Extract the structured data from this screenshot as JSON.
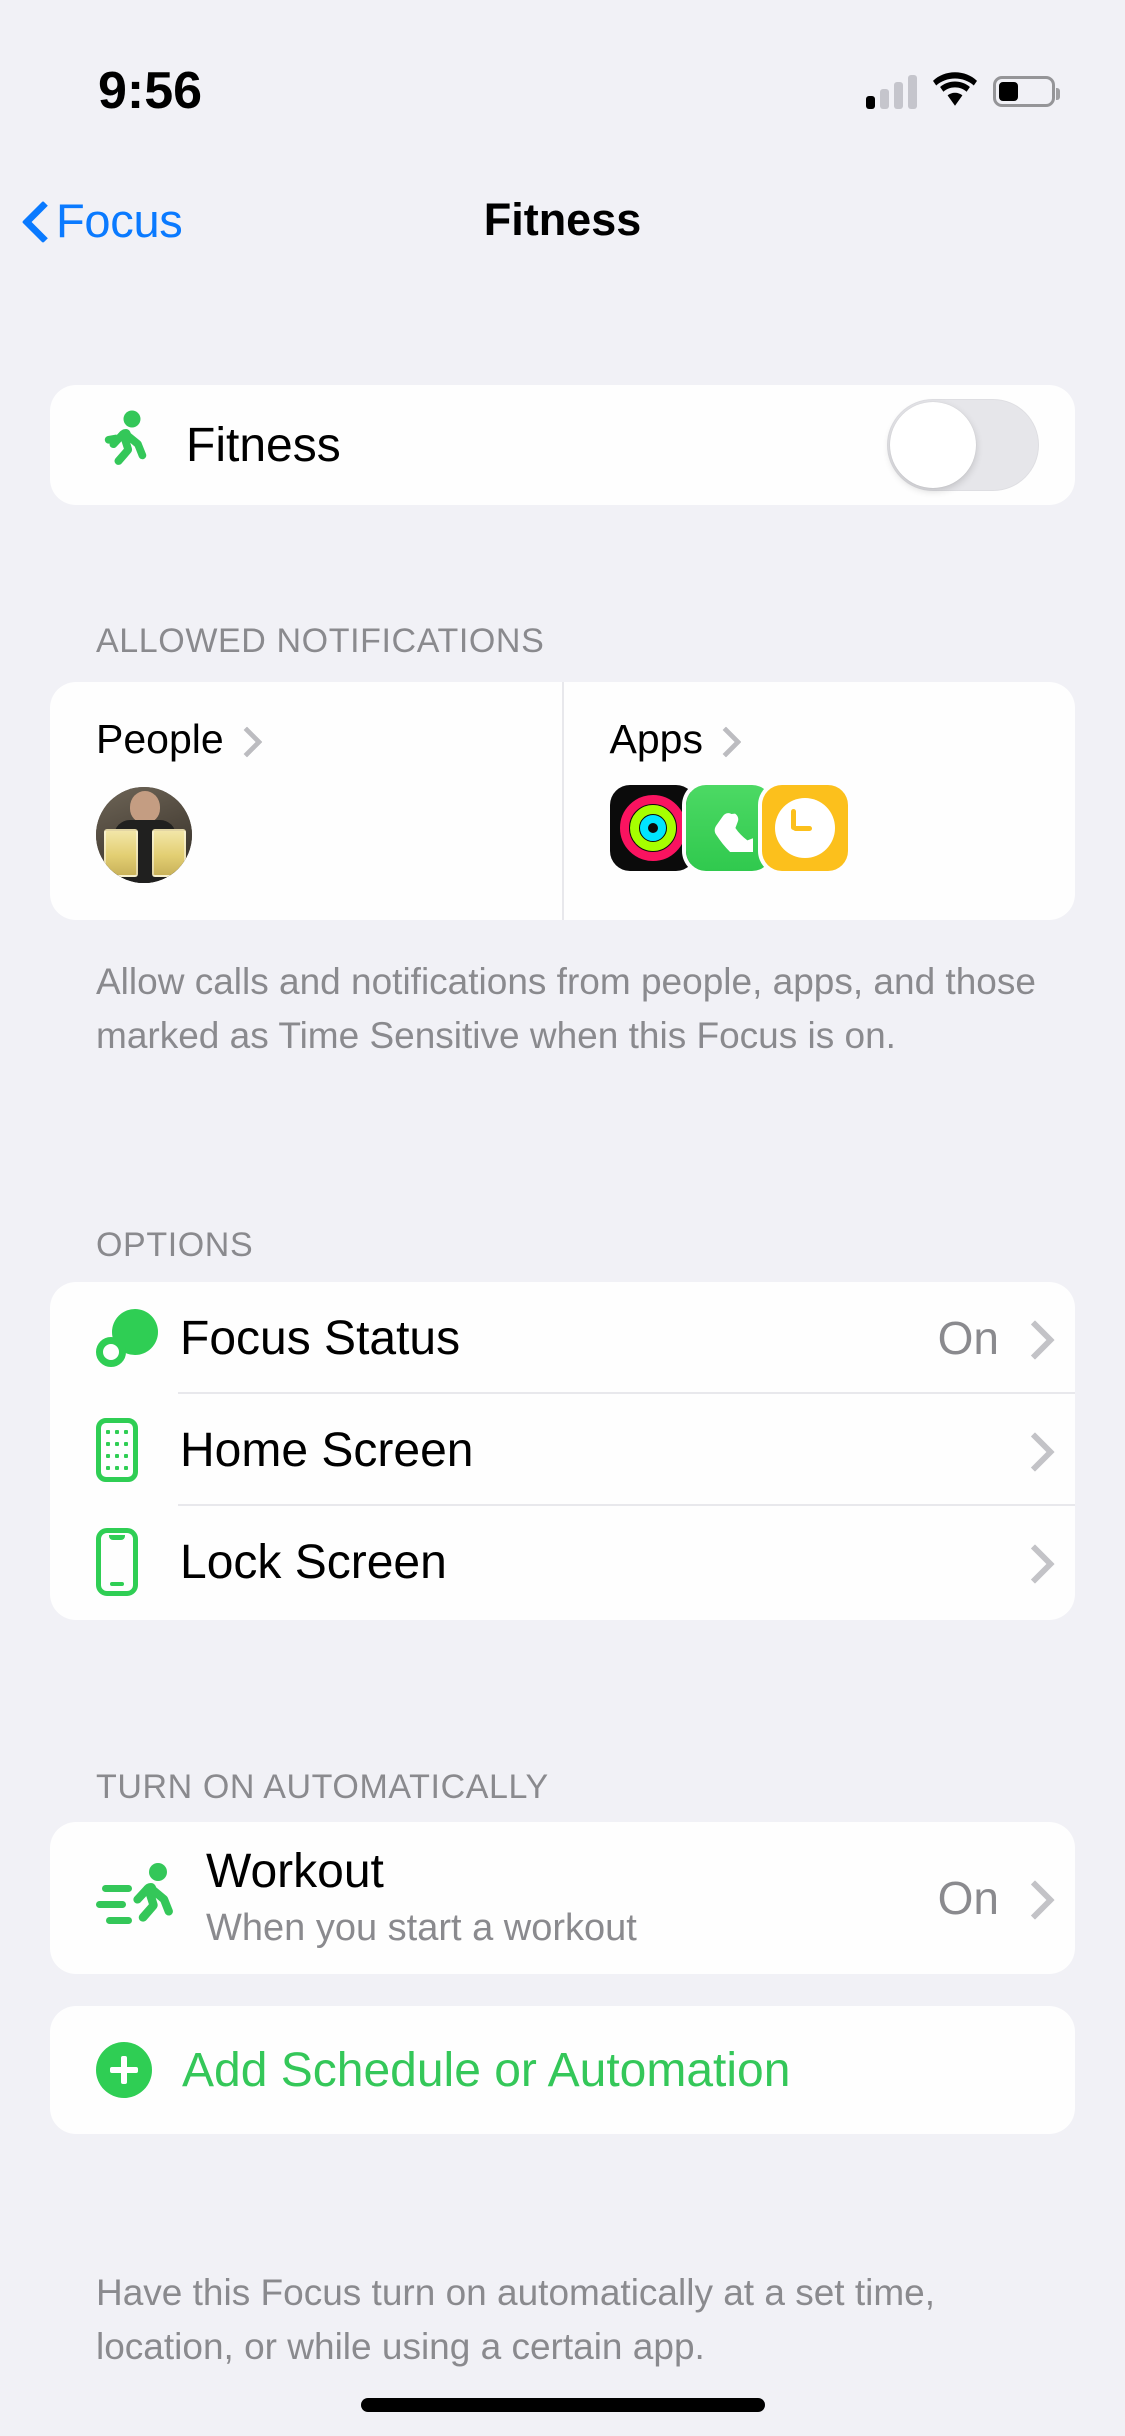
{
  "status_bar": {
    "time": "9:56",
    "cellular_icon": "cellular-bars-icon",
    "cellular_bars_active": 1,
    "cellular_bars_total": 4,
    "wifi_icon": "wifi-icon",
    "battery_icon": "battery-icon",
    "battery_level_percent": 38
  },
  "nav": {
    "back_label": "Focus",
    "back_icon": "chevron-left-icon",
    "title": "Fitness"
  },
  "main_toggle": {
    "icon": "running-person-icon",
    "label": "Fitness",
    "state": "off"
  },
  "allowed_notifications": {
    "header": "ALLOWED NOTIFICATIONS",
    "people": {
      "label": "People",
      "chevron_icon": "chevron-right-icon",
      "avatar_icon": "contact-avatar"
    },
    "apps": {
      "label": "Apps",
      "chevron_icon": "chevron-right-icon",
      "app_icons": [
        "fitness-app-icon",
        "phone-app-icon",
        "clock-app-icon"
      ]
    },
    "footnote": "Allow calls and notifications from people, apps, and those marked as Time Sensitive when this Focus is on."
  },
  "options": {
    "header": "OPTIONS",
    "rows": [
      {
        "icon": "focus-status-icon",
        "label": "Focus Status",
        "value": "On",
        "chevron_icon": "chevron-right-icon"
      },
      {
        "icon": "home-screen-icon",
        "label": "Home Screen",
        "value": "",
        "chevron_icon": "chevron-right-icon"
      },
      {
        "icon": "lock-screen-icon",
        "label": "Lock Screen",
        "value": "",
        "chevron_icon": "chevron-right-icon"
      }
    ]
  },
  "turn_on_automatically": {
    "header": "TURN ON AUTOMATICALLY",
    "workout": {
      "icon": "running-person-motion-icon",
      "title": "Workout",
      "subtitle": "When you start a workout",
      "value": "On",
      "chevron_icon": "chevron-right-icon"
    },
    "add": {
      "icon": "plus-circle-icon",
      "label": "Add Schedule or Automation"
    },
    "footnote": "Have this Focus turn on automatically at a set time, location, or while using a certain app."
  },
  "colors": {
    "accent_blue": "#0a7aff",
    "accent_green": "#34c759",
    "icon_green": "#2fce54",
    "background": "#f1f1f6",
    "card": "#fefefe",
    "secondary_text": "#8a8a8e"
  },
  "home_indicator": "home-indicator"
}
